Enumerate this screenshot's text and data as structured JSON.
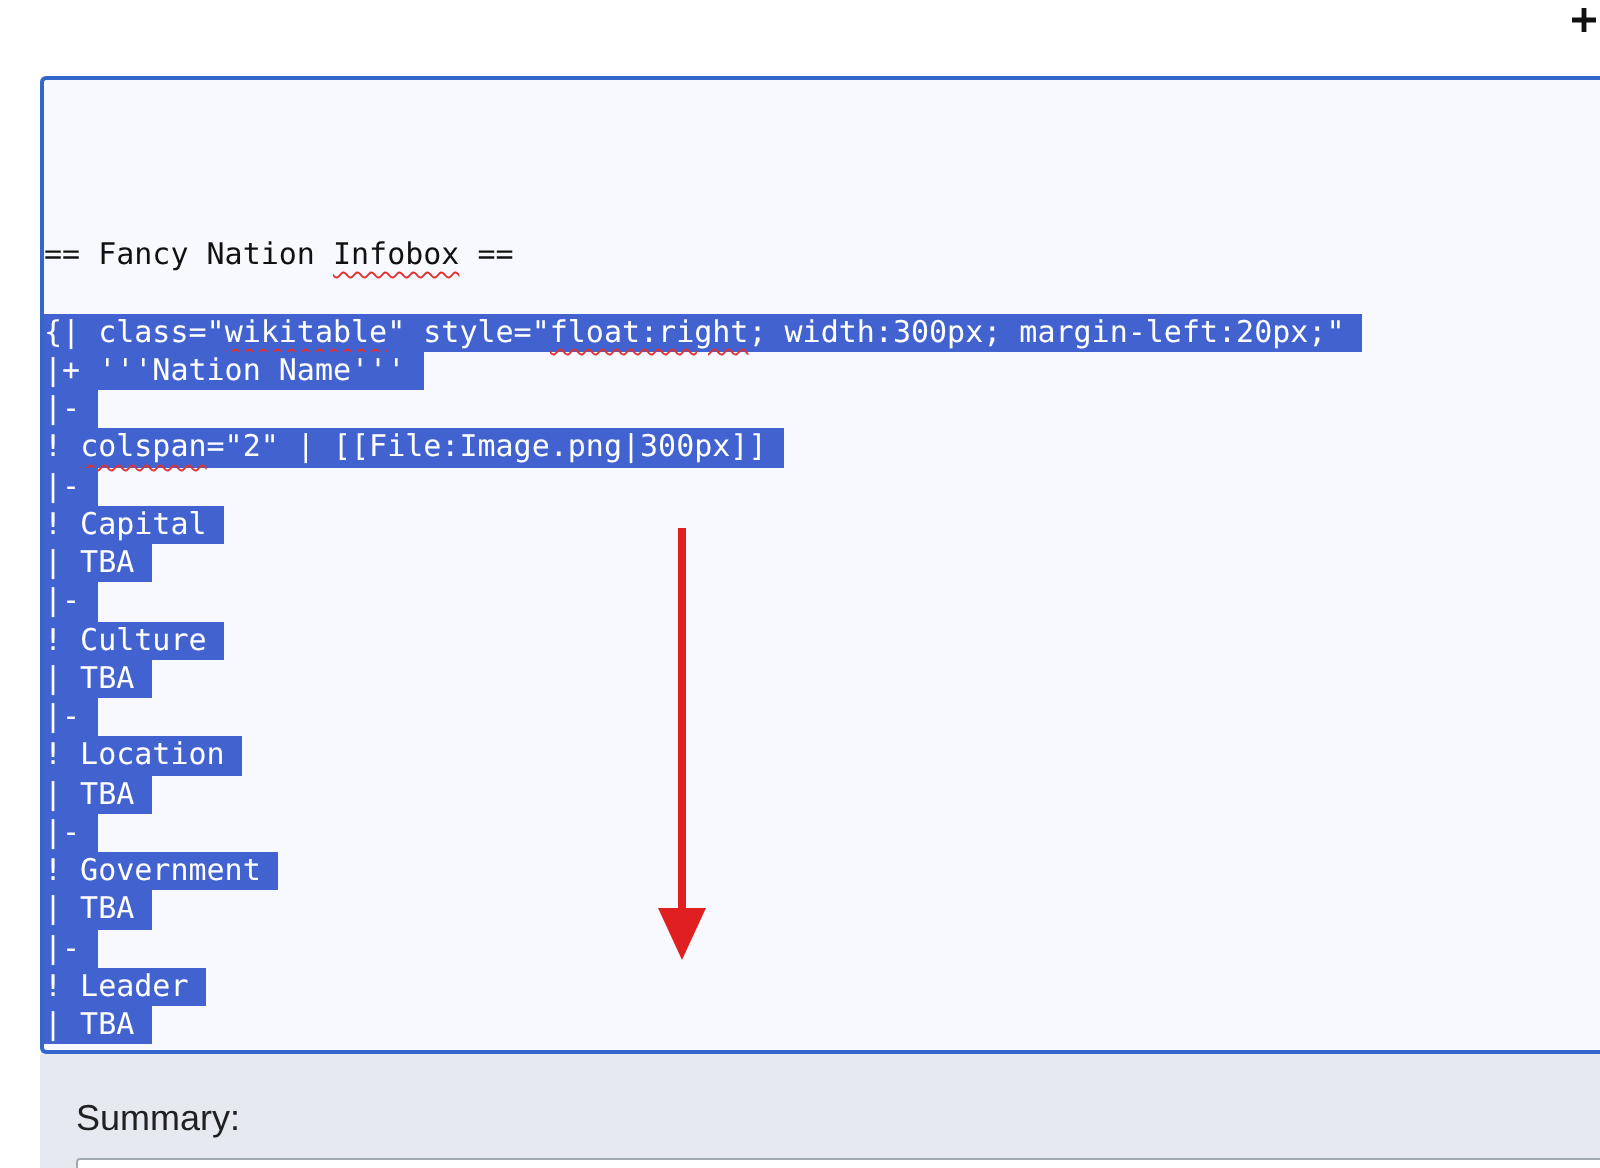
{
  "editor": {
    "lines": [
      {
        "kind": "blank"
      },
      {
        "kind": "blank"
      },
      {
        "kind": "blank"
      },
      {
        "kind": "blank"
      },
      {
        "kind": "text",
        "selected": false,
        "segments": [
          {
            "text": "== Fancy Nation ",
            "misspelled": false
          },
          {
            "text": "Infobox",
            "misspelled": true
          },
          {
            "text": " ==",
            "misspelled": false
          }
        ]
      },
      {
        "kind": "blank"
      },
      {
        "kind": "text",
        "selected": true,
        "segments": [
          {
            "text": "{| class=\"",
            "misspelled": false
          },
          {
            "text": "wikitable",
            "misspelled": true
          },
          {
            "text": "\" style=\"",
            "misspelled": false
          },
          {
            "text": "float:right",
            "misspelled": true
          },
          {
            "text": "; width:300px; margin-left:20px;\"",
            "misspelled": false
          }
        ]
      },
      {
        "kind": "text",
        "selected": true,
        "segments": [
          {
            "text": "|+ '''Nation Name'''",
            "misspelled": false
          }
        ]
      },
      {
        "kind": "text",
        "selected": true,
        "segments": [
          {
            "text": "|-",
            "misspelled": false
          }
        ]
      },
      {
        "kind": "text",
        "selected": true,
        "segments": [
          {
            "text": "! ",
            "misspelled": false
          },
          {
            "text": "colspan",
            "misspelled": true
          },
          {
            "text": "=\"2\" | [[File:Image.png|300px]]",
            "misspelled": false
          }
        ]
      },
      {
        "kind": "text",
        "selected": true,
        "segments": [
          {
            "text": "|-",
            "misspelled": false
          }
        ]
      },
      {
        "kind": "text",
        "selected": true,
        "segments": [
          {
            "text": "! Capital",
            "misspelled": false
          }
        ]
      },
      {
        "kind": "text",
        "selected": true,
        "segments": [
          {
            "text": "| TBA",
            "misspelled": false
          }
        ]
      },
      {
        "kind": "text",
        "selected": true,
        "segments": [
          {
            "text": "|-",
            "misspelled": false
          }
        ]
      },
      {
        "kind": "text",
        "selected": true,
        "segments": [
          {
            "text": "! Culture",
            "misspelled": false
          }
        ]
      },
      {
        "kind": "text",
        "selected": true,
        "segments": [
          {
            "text": "| TBA",
            "misspelled": false
          }
        ]
      },
      {
        "kind": "text",
        "selected": true,
        "segments": [
          {
            "text": "|-",
            "misspelled": false
          }
        ]
      },
      {
        "kind": "text",
        "selected": true,
        "segments": [
          {
            "text": "! Location",
            "misspelled": false
          }
        ]
      },
      {
        "kind": "text",
        "selected": true,
        "segments": [
          {
            "text": "| TBA",
            "misspelled": false
          }
        ]
      },
      {
        "kind": "text",
        "selected": true,
        "segments": [
          {
            "text": "|-",
            "misspelled": false
          }
        ]
      },
      {
        "kind": "text",
        "selected": true,
        "segments": [
          {
            "text": "! Government",
            "misspelled": false
          }
        ]
      },
      {
        "kind": "text",
        "selected": true,
        "segments": [
          {
            "text": "| TBA",
            "misspelled": false
          }
        ]
      },
      {
        "kind": "text",
        "selected": true,
        "segments": [
          {
            "text": "|-",
            "misspelled": false
          }
        ]
      },
      {
        "kind": "text",
        "selected": true,
        "segments": [
          {
            "text": "! Leader",
            "misspelled": false
          }
        ]
      },
      {
        "kind": "text",
        "selected": true,
        "segments": [
          {
            "text": "| TBA",
            "misspelled": false
          }
        ]
      }
    ]
  },
  "summary": {
    "label": "Summary:"
  }
}
